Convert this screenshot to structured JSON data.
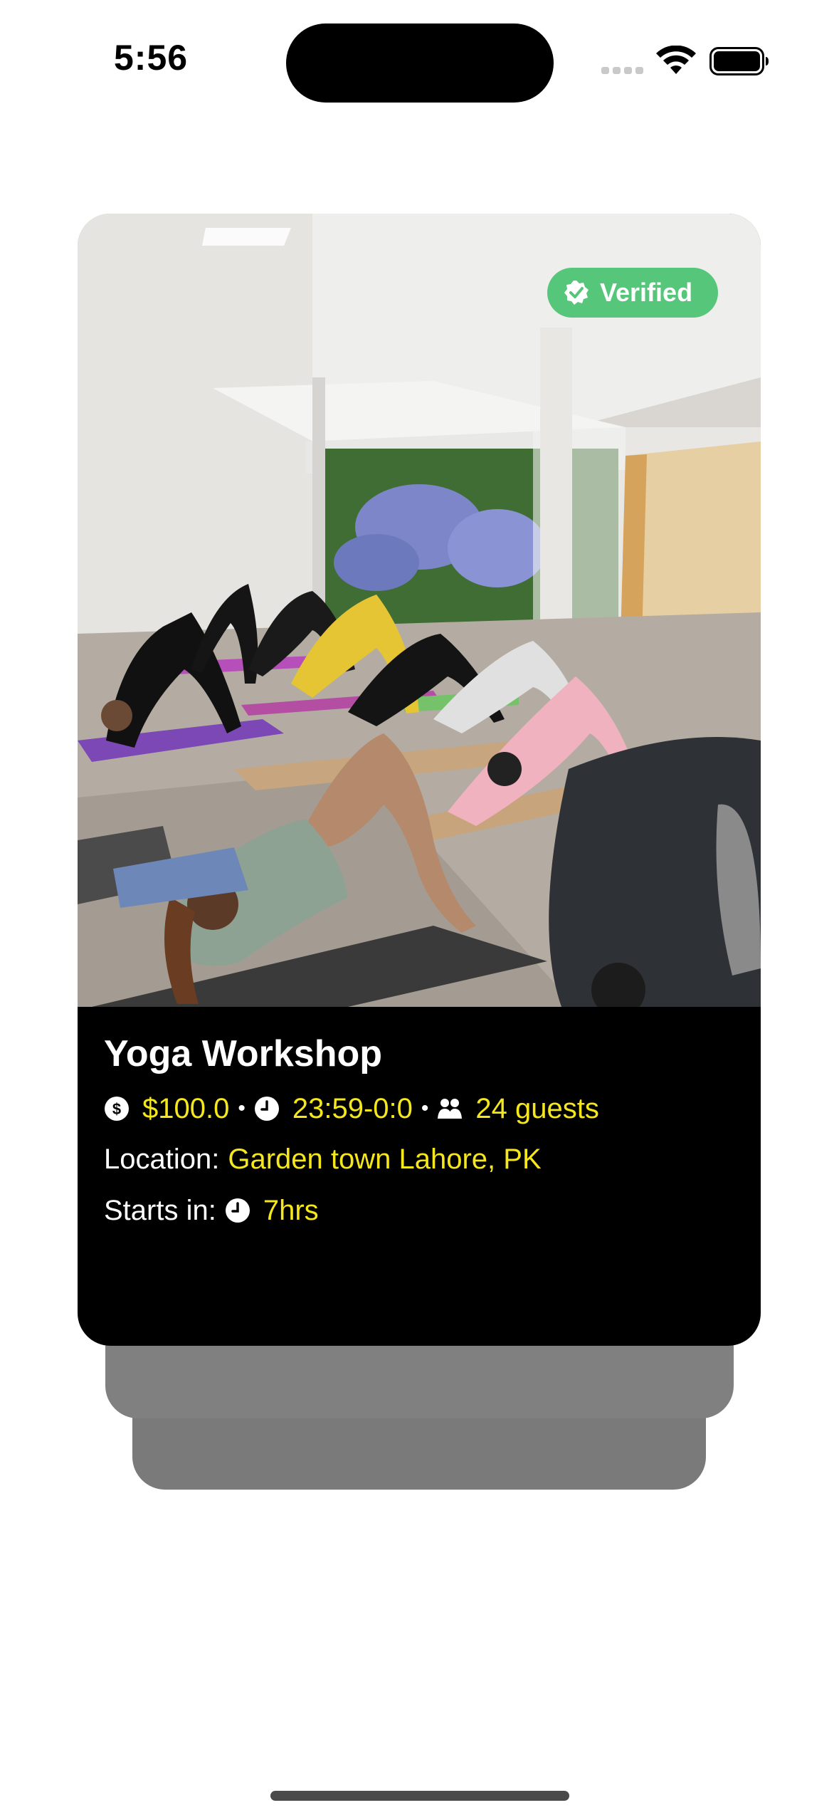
{
  "status_bar": {
    "time": "5:56"
  },
  "card": {
    "badge": {
      "label": "Verified",
      "icon": "verified-check-icon",
      "color": "#55c67a"
    },
    "image": {
      "icon": "yoga-class-photo"
    },
    "title": "Yoga Workshop",
    "meta": {
      "price": "$100.0",
      "time": "23:59-0:0",
      "guests": "24 guests",
      "separator": "•"
    },
    "location": {
      "label": "Location:",
      "value": "Garden town Lahore, PK"
    },
    "starts_in": {
      "label": "Starts in:",
      "value": "7hrs"
    }
  },
  "colors": {
    "accent": "#f5e71b",
    "card_background": "#000000",
    "stack_card": "#7a7a7a"
  }
}
